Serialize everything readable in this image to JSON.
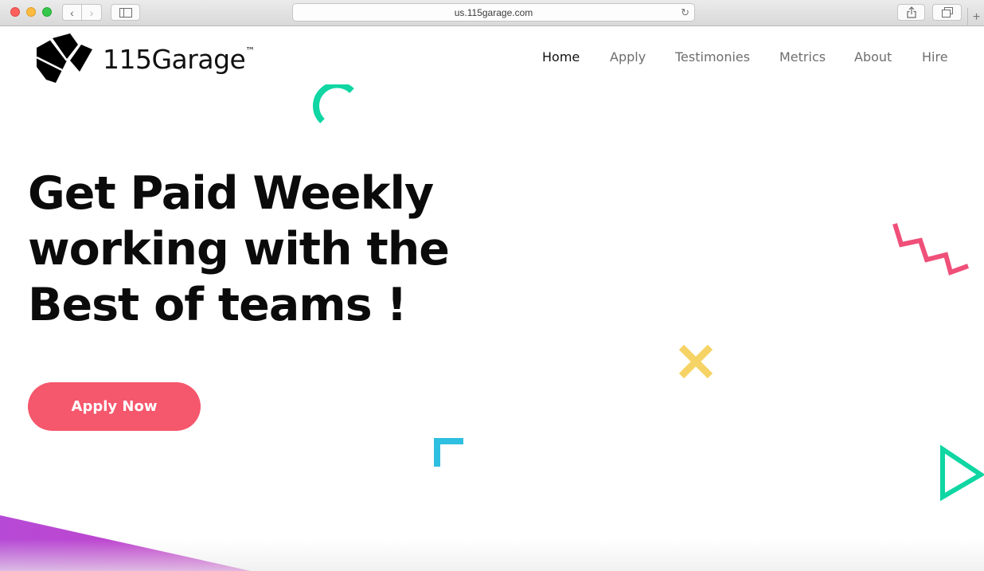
{
  "browser": {
    "url": "us.115garage.com",
    "traffic_lights": [
      "close",
      "minimize",
      "zoom"
    ],
    "icons": {
      "back": "chevron-left-icon",
      "forward": "chevron-right-icon",
      "sidebar": "sidebar-icon",
      "reload": "reload-icon",
      "share": "share-icon",
      "tabs": "tab-overview-icon",
      "new_tab": "plus-icon"
    }
  },
  "header": {
    "brand": "115Garage",
    "trademark": "™",
    "nav": [
      "Home",
      "Apply",
      "Testimonies",
      "Metrics",
      "About",
      "Hire"
    ],
    "active_nav": "Home"
  },
  "hero": {
    "title_lines": [
      "Get Paid Weekly",
      "working with the",
      "Best of teams !"
    ],
    "cta": "Apply Now"
  },
  "colors": {
    "cta": "#f5576c",
    "teal": "#0fd6a3",
    "pink": "#ef4f78",
    "yellow": "#f6d365",
    "cyan": "#2fbfe0",
    "purple": "#b64ad6"
  }
}
